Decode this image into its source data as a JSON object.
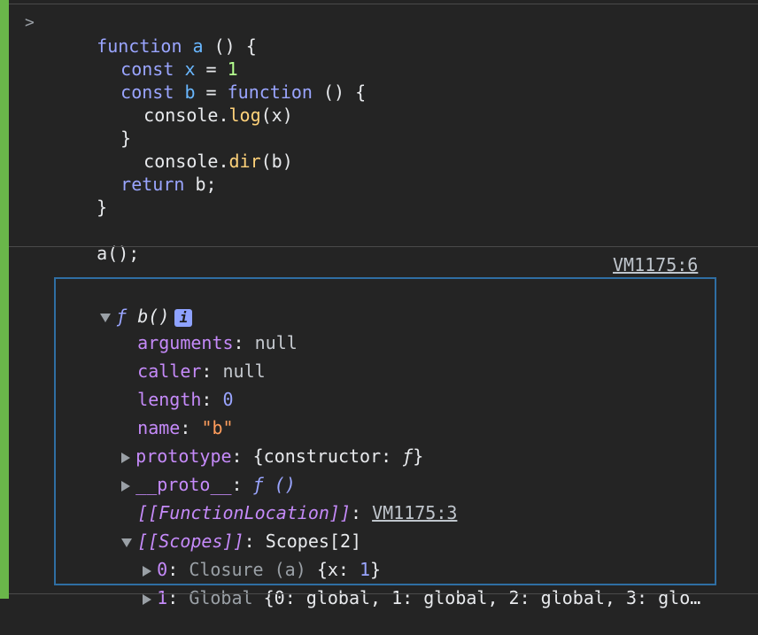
{
  "console": {
    "prompt_symbol": ">",
    "input_lines": {
      "l1": {
        "kw": "function",
        "sp": " ",
        "fn": "a",
        "rest": " () {"
      },
      "l2": {
        "kw": "const",
        "sp": " ",
        "fn": "x",
        "op": " = ",
        "num": "1"
      },
      "l3": {
        "kw": "const",
        "sp": " ",
        "fn": "b",
        "op": " = ",
        "kw2": "function",
        "rest": " () {"
      },
      "l4": {
        "obj": "console.",
        "method": "log",
        "rest": "(x)"
      },
      "l5": {
        "rest": "}"
      },
      "l6": {
        "obj": "console.",
        "method": "dir",
        "rest": "(b)"
      },
      "l7": {
        "kw": "return",
        "rest": " b;"
      },
      "l8": {
        "rest": "}"
      },
      "l9": {
        "rest": "a();"
      }
    },
    "vm_link": "VM1175:6",
    "object_header": {
      "f": "ƒ",
      "name": "b()",
      "info": "i"
    },
    "props": {
      "arguments": {
        "key": "arguments",
        "val": "null"
      },
      "caller": {
        "key": "caller",
        "val": "null"
      },
      "length": {
        "key": "length",
        "val": "0"
      },
      "name": {
        "key": "name",
        "val": "\"b\""
      },
      "prototype": {
        "key": "prototype",
        "val": "{constructor: ",
        "f": "ƒ",
        "close": "}"
      },
      "proto": {
        "key": "__proto__",
        "f": "ƒ ()"
      },
      "function_location": {
        "key": "[[FunctionLocation]]",
        "val": "VM1175:3"
      },
      "scopes": {
        "key": "[[Scopes]]",
        "val": "Scopes[2]"
      },
      "scope0": {
        "idx": "0",
        "label": "Closure (a) ",
        "open": "{x: ",
        "num": "1",
        "close": "}"
      },
      "scope1": {
        "idx": "1",
        "label": "Global ",
        "val": "{0: global, 1: global, 2: global, 3: glo…"
      }
    }
  }
}
